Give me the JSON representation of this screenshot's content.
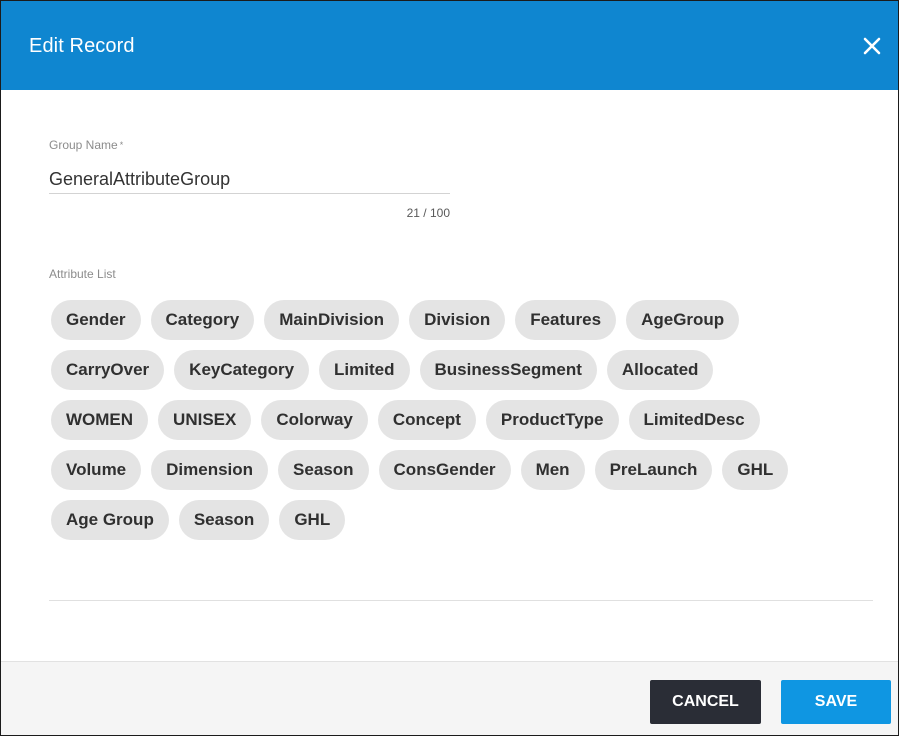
{
  "dialog": {
    "title": "Edit Record",
    "close_icon": "close-icon",
    "accent_color": "#0f86d0"
  },
  "group_name": {
    "label": "Group Name",
    "required_mark": "*",
    "value": "GeneralAttributeGroup",
    "char_count": "21 / 100"
  },
  "attribute_list": {
    "label": "Attribute List",
    "rows": [
      [
        "Gender",
        "Category",
        "MainDivision",
        "Division",
        "Features",
        "AgeGroup"
      ],
      [
        "CarryOver",
        "KeyCategory",
        "Limited",
        "BusinessSegment",
        "Allocated"
      ],
      [
        "WOMEN",
        "UNISEX",
        "Colorway",
        "Concept",
        "ProductType",
        "LimitedDesc"
      ],
      [
        "Volume",
        "Dimension",
        "Season",
        "ConsGender",
        "Men",
        "PreLaunch",
        "GHL"
      ],
      [
        "Age Group",
        "Season",
        "GHL"
      ]
    ]
  },
  "footer": {
    "cancel_label": "CANCEL",
    "save_label": "SAVE",
    "cancel_color": "#2a2d36",
    "save_color": "#0f96e2"
  }
}
